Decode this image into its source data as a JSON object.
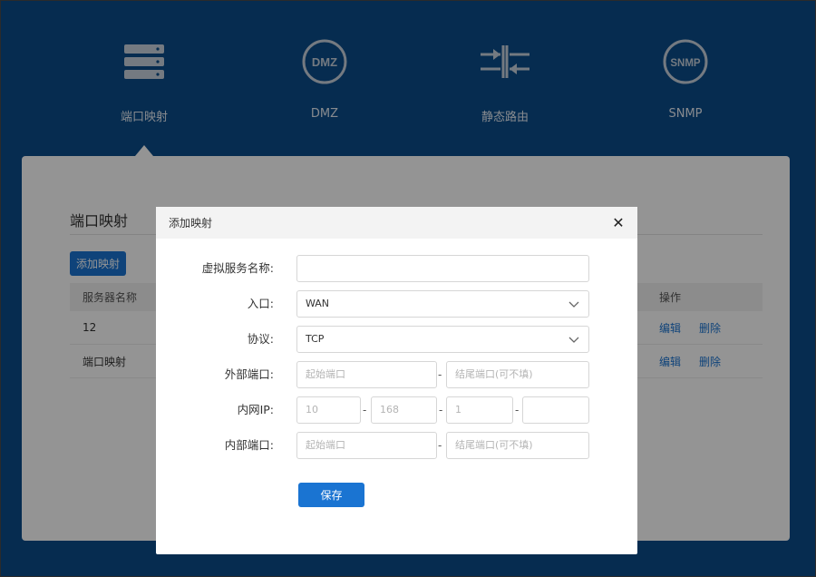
{
  "nav": {
    "items": [
      {
        "label": "端口映射",
        "icon": "server-stack-icon"
      },
      {
        "label": "DMZ",
        "icon": "dmz-badge-icon",
        "badge": "DMZ"
      },
      {
        "label": "静态路由",
        "icon": "route-arrows-icon"
      },
      {
        "label": "SNMP",
        "icon": "snmp-badge-icon",
        "badge": "SNMP"
      }
    ],
    "active_index": 0
  },
  "page": {
    "title": "端口映射",
    "add_button": "添加映射",
    "table": {
      "headers": [
        "服务器名称",
        "操作"
      ],
      "rows": [
        {
          "name": "12",
          "edit": "编辑",
          "delete": "删除"
        },
        {
          "name": "端口映射",
          "edit": "编辑",
          "delete": "删除"
        }
      ]
    }
  },
  "modal": {
    "title": "添加映射",
    "close_symbol": "✕",
    "fields": {
      "service_name": {
        "label": "虚拟服务名称:",
        "value": ""
      },
      "entry": {
        "label": "入口:",
        "value": "WAN"
      },
      "protocol": {
        "label": "协议:",
        "value": "TCP"
      },
      "external_port": {
        "label": "外部端口:",
        "start_placeholder": "起始端口",
        "end_placeholder": "结尾端口(可不填)",
        "separator": "-"
      },
      "internal_ip": {
        "label": "内网IP:",
        "octets": [
          "10",
          "168",
          "1",
          ""
        ],
        "separator": "-"
      },
      "internal_port": {
        "label": "内部端口:",
        "start_placeholder": "起始端口",
        "end_placeholder": "结尾端口(可不填)",
        "separator": "-"
      }
    },
    "save_button": "保存"
  },
  "colors": {
    "header_bg": "#0b4d8a",
    "accent": "#1a74d2",
    "overlay": "rgba(0,0,0,0.42)"
  }
}
